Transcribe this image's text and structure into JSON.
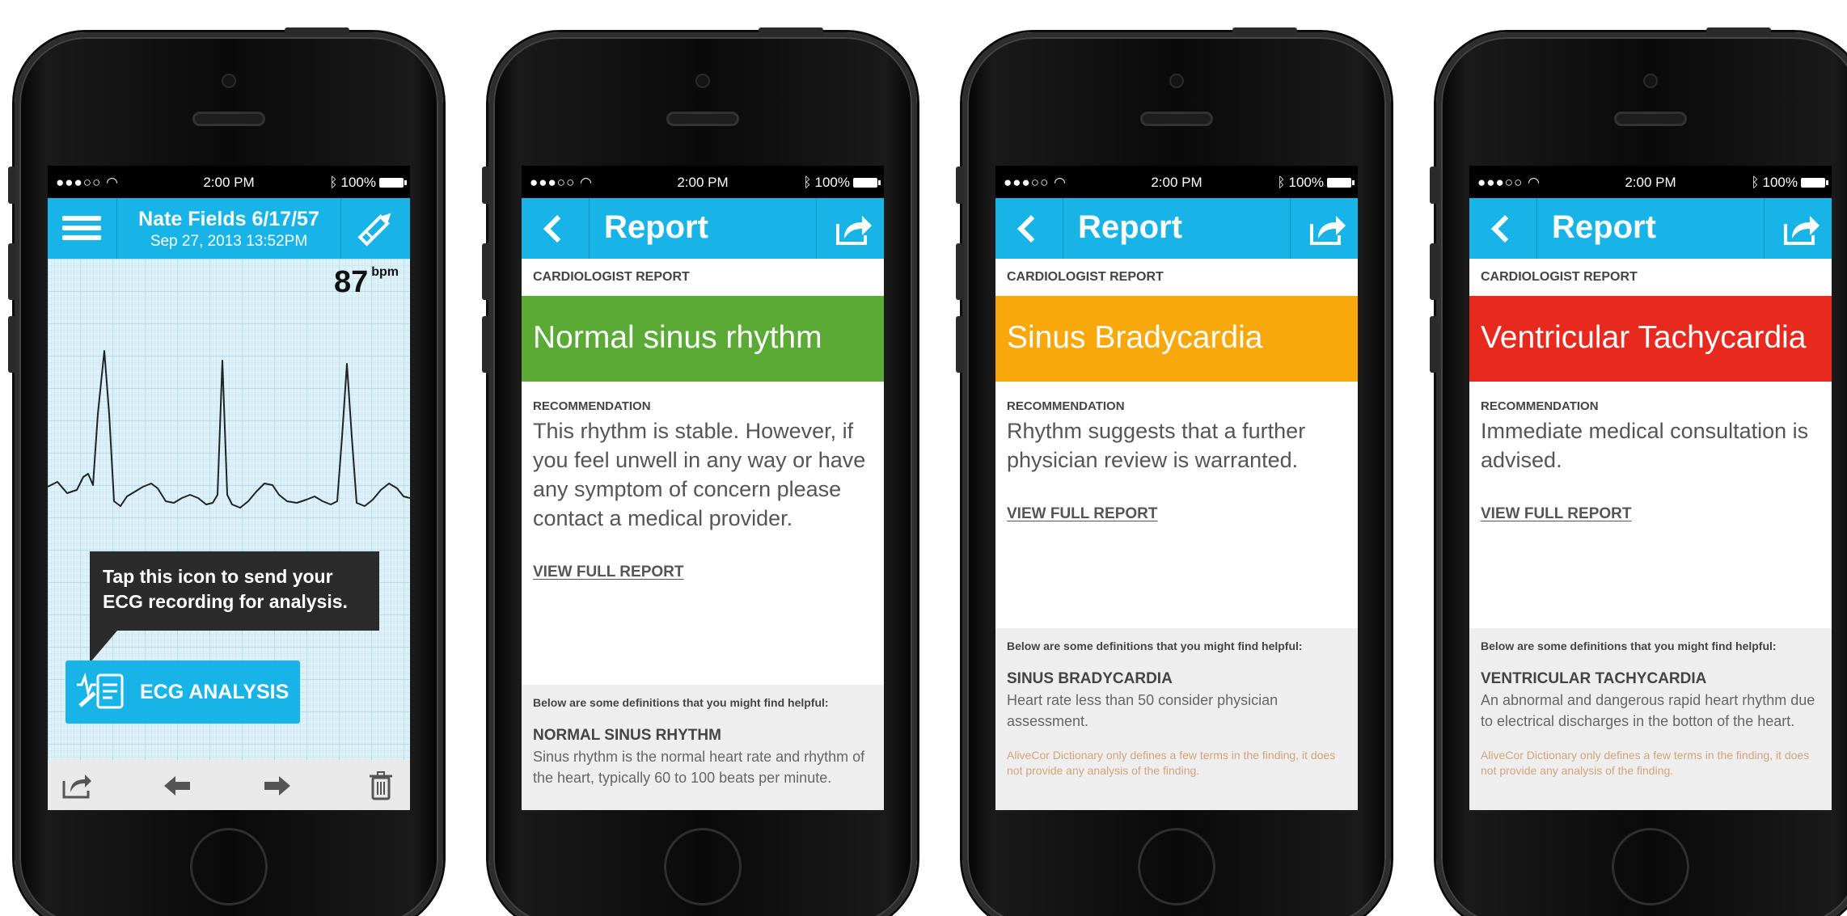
{
  "status_bar": {
    "signal": "●●●○○",
    "time": "2:00 PM",
    "battery": "100%"
  },
  "ecg_screen": {
    "patient": "Nate Fields 6/17/57",
    "recorded": "Sep 27, 2013  13:52PM",
    "heart_rate": "87",
    "heart_rate_unit": "bpm",
    "tooltip": "Tap this icon to send your ECG recording for analysis.",
    "analysis_button": "ECG ANALYSIS",
    "icons": [
      "menu-icon",
      "pencil-icon",
      "share-icon",
      "arrow-left-icon",
      "arrow-right-icon",
      "trash-icon"
    ]
  },
  "report_common": {
    "title": "Report",
    "section_label": "CARDIOLOGIST REPORT",
    "recommendation_label": "RECOMMENDATION",
    "view_full_report": "VIEW FULL REPORT",
    "definitions_intro": "Below are some definitions that you might find helpful:",
    "disclaimer": "AliveCor Dictionary only defines a few terms in the finding, it does not provide any analysis of the finding."
  },
  "reports": [
    {
      "finding": "Normal sinus rhythm",
      "color": "#5aaa35",
      "recommendation": "This rhythm is stable. However, if you feel unwell in any way or have any symptom of concern please contact a medical provider.",
      "term": "NORMAL SINUS RHYTHM",
      "definition": "Sinus rhythm is the normal heart rate and rhythm of the heart, typically 60 to 100 beats per minute."
    },
    {
      "finding": "Sinus Bradycardia",
      "color": "#f9a80c",
      "recommendation": "Rhythm suggests that a further physician review is warranted.",
      "term": "SINUS BRADYCARDIA",
      "definition": "Heart rate less than 50 consider physician assessment."
    },
    {
      "finding": "Ventricular Tachycardia",
      "color": "#e8291e",
      "recommendation": "Immediate medical consultation is advised.",
      "term": "VENTRICULAR TACHYCARDIA",
      "definition": "An abnormal and dangerous rapid heart rhythm due to electrical discharges in the botton of the heart."
    }
  ]
}
